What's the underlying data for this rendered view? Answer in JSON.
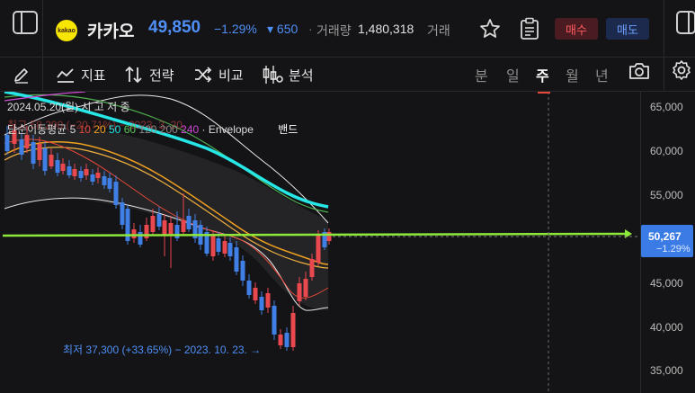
{
  "header": {
    "logo_text": "kakao",
    "stock_name": "카카오",
    "price": "49,850",
    "change_pct": "−1.29%",
    "change_abs": "▾ 650",
    "separator": "·",
    "volume_label": "거래량",
    "volume_value": "1,480,318",
    "next_label": "거래",
    "buy_label": "매수",
    "sell_label": "매도"
  },
  "toolbar": {
    "indicator_label": "지표",
    "strategy_label": "전략",
    "compare_label": "비교",
    "analysis_label": "분석",
    "periods": [
      "분",
      "일",
      "주",
      "월",
      "년"
    ],
    "active_period": "주"
  },
  "legend": {
    "date_line": "2024.05.20(월)  시   고   저   종",
    "history_line": "최고 58,200 (−20.71%) − 2023. 3. 20.",
    "ma_title": "단순이동평균 5",
    "ma_10": "10",
    "ma_20": "20",
    "ma_50": "50",
    "ma_60": "60",
    "ma_120": "120",
    "ma_200": "200",
    "ma_240": "240",
    "envelope": "· Envelope",
    "band": "밴드"
  },
  "price_axis": {
    "labels": [
      "65,000",
      "60,000",
      "55,000",
      "50,000",
      "45,000",
      "40,000",
      "35,000"
    ],
    "current_tag": "50,267",
    "current_sub": "−1.29%"
  },
  "annotations": {
    "low": "최저 37,300 (+33.65%) − 2023. 10. 23. →"
  },
  "colors": {
    "up": "#e8484e",
    "down": "#3f7fe6",
    "accent": "#4f8ff7",
    "trendline": "#8ee83a",
    "ma_cyan": "#27e6e6",
    "ma_orange": "#f0a020",
    "ma_red": "#e8483a",
    "ma_green": "#5ac85a"
  }
}
